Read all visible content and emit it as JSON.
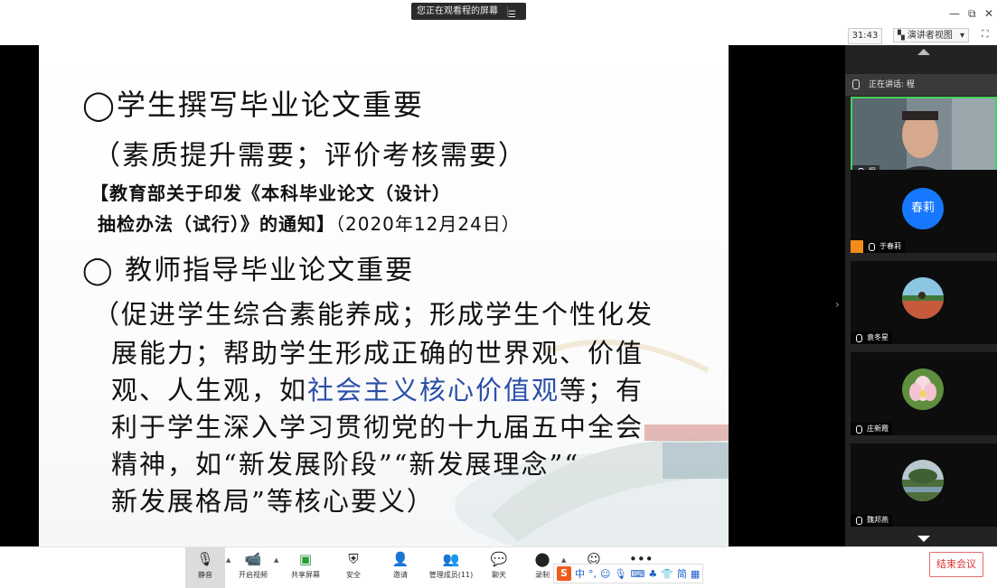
{
  "titlebar": {
    "share_text": "您正在观看程的屏幕",
    "minimize": "—",
    "restore": "⧉",
    "close": "✕"
  },
  "controls": {
    "timer": "31:43",
    "view_label": "演讲者视图",
    "view_caret": "▾",
    "fullscreen": "⛶"
  },
  "slide": {
    "line1": "◯学生撰写毕业论文重要",
    "line2": "（素质提升需要；评价考核需要）",
    "line3": "【教育部关于印发《本科毕业论文（设计）",
    "line4": "抽检办法（试行）》的通知】",
    "line4_date": "（2020年12月24日）",
    "line5": "◯  教师指导毕业论文重要",
    "line6": "（促进学生综合素能养成；形成学生个性化发",
    "line7": "展能力；帮助学生形成正确的世界观、价值",
    "line8_pre": "观、人生观，如",
    "line8_hl": "社会主义核心价值观",
    "line8_post": "等；有",
    "line9": "利于学生深入学习贯彻党的十九届五中全会",
    "line10": "精神，如“新发展阶段”“新发展理念”“",
    "line11": "新发展格局”等核心要义）"
  },
  "participants": {
    "speaking_label": "正在讲话: 程",
    "tiles": [
      {
        "name": "程"
      },
      {
        "name": "于春莉",
        "avatar_text": "春莉"
      },
      {
        "name": "袁冬星"
      },
      {
        "name": "庄新霞"
      },
      {
        "name": "魏邦燕"
      }
    ]
  },
  "toolbar": {
    "mute": "静音",
    "start_video": "开启视频",
    "share_screen": "共享屏幕",
    "security": "安全",
    "invite": "邀请",
    "manage_members": "管理成员(11)",
    "chat": "聊天",
    "record": "录制",
    "reactions": "",
    "more": "",
    "end_meeting": "结束会议"
  },
  "ime": {
    "logo": "S",
    "items": [
      "中",
      "°,",
      "☺",
      "🎙",
      "⌨",
      "♣",
      "👕",
      "简",
      "▦"
    ]
  },
  "colors": {
    "highlight_text": "#2a4ea8",
    "speaking_border": "#49d05a",
    "end_button": "#d33333",
    "avatar_blue": "#1677ff"
  }
}
